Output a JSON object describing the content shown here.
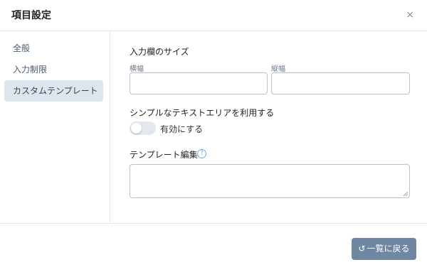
{
  "dialog": {
    "title": "項目設定",
    "close_glyph": "×"
  },
  "sidebar": {
    "items": [
      {
        "label": "全般",
        "active": false
      },
      {
        "label": "入力制限",
        "active": false
      },
      {
        "label": "カスタムテンプレート",
        "active": true
      }
    ]
  },
  "main": {
    "size_section": {
      "label": "入力欄のサイズ",
      "width_label": "横幅",
      "width_value": "",
      "height_label": "縦幅",
      "height_value": ""
    },
    "simple_textarea": {
      "label": "シンプルなテキストエリアを利用する",
      "toggle_label": "有効にする",
      "enabled": false
    },
    "template_edit": {
      "label": "テンプレート編集",
      "help_glyph": "?",
      "value": ""
    }
  },
  "footer": {
    "back_button_label": "一覧に戻る",
    "back_button_icon": "undo-icon",
    "back_button_glyph": "↺"
  },
  "colors": {
    "primary_button": "#6f87a3",
    "active_sidebar_bg": "#dfe5ee",
    "border": "#b7c2cf"
  }
}
